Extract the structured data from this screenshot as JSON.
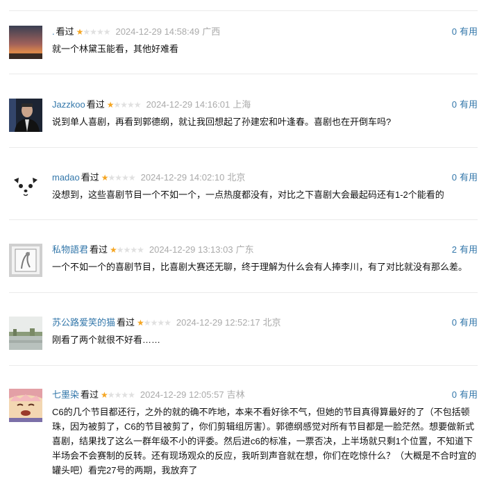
{
  "vote_label": "有用",
  "star_on": "★",
  "star_off": "★",
  "comments": [
    {
      "user": ".",
      "status": "看过",
      "rating": 1,
      "time": "2024-12-29 14:58:49",
      "location": "广西",
      "votes": "0",
      "text": "就一个林黛玉能看，其他好难看"
    },
    {
      "user": "Jazzkoo",
      "status": "看过",
      "rating": 1,
      "time": "2024-12-29 14:16:01",
      "location": "上海",
      "votes": "0",
      "text": "说到单人喜剧，再看到郭德纲，就让我回想起了孙建宏和叶逢春。喜剧也在开倒车吗?"
    },
    {
      "user": "madao",
      "status": "看过",
      "rating": 1,
      "time": "2024-12-29 14:02:10",
      "location": "北京",
      "votes": "0",
      "text": "没想到，这些喜剧节目一个不如一个，一点热度都没有，对比之下喜剧大会最起码还有1-2个能看的"
    },
    {
      "user": "私物語君",
      "status": "看过",
      "rating": 1,
      "time": "2024-12-29 13:13:03",
      "location": "广东",
      "votes": "2",
      "text": "一个不如一个的喜剧节目，比喜剧大赛还无聊，终于理解为什么会有人捧李川，有了对比就没有那么差。"
    },
    {
      "user": "苏公路爱笑的猫",
      "status": "看过",
      "rating": 1,
      "time": "2024-12-29 12:52:17",
      "location": "北京",
      "votes": "0",
      "text": "刚看了两个就很不好看……"
    },
    {
      "user": "七墨染",
      "status": "看过",
      "rating": 1,
      "time": "2024-12-29 12:05:57",
      "location": "吉林",
      "votes": "0",
      "text": "C6的几个节目都还行，之外的就的确不咋地，本来不看好徐不气，但她的节目真得算最好的了（不包括顿珠，因为被剪了，C6的节目被剪了，你们剪辑组厉害）。郭德纲感觉对所有节目都是一脸茫然。想要做新式喜剧，结果找了这么一群年级不小的评委。然后进c6的标准，一票否决，上半场就只剩1个位置，不知道下半场会不会赛制的反转。还有现场观众的反应，我听到声音就在想，你们在吃惊什么？（大概是不合时宜的罐头吧）看完27号的两期，我放弃了"
    }
  ]
}
